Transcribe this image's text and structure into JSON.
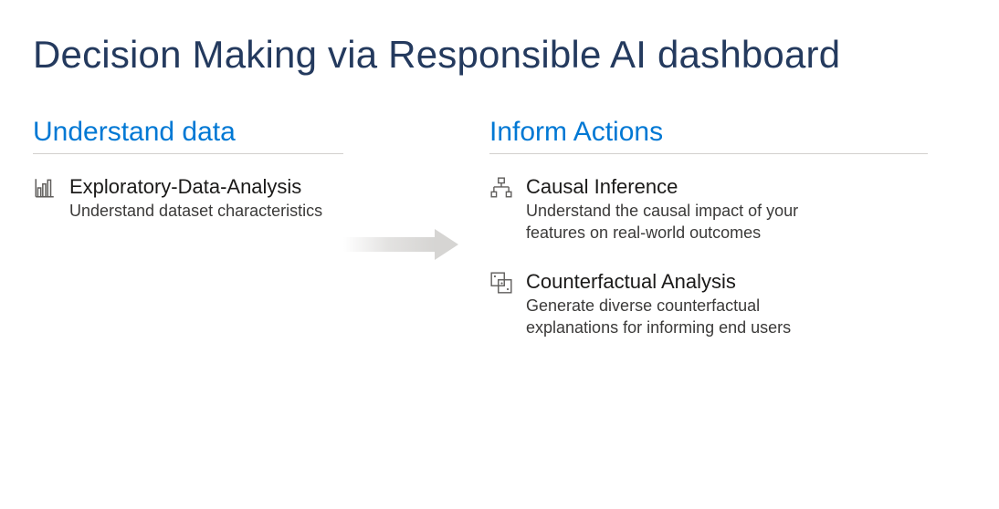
{
  "title": "Decision Making via Responsible AI dashboard",
  "left": {
    "heading": "Understand data",
    "items": [
      {
        "icon": "bar-chart-icon",
        "title": "Exploratory-Data-Analysis",
        "desc": "Understand dataset characteristics"
      }
    ]
  },
  "right": {
    "heading": "Inform Actions",
    "items": [
      {
        "icon": "hierarchy-icon",
        "title": "Causal Inference",
        "desc": "Understand the causal impact of your features on real-world outcomes"
      },
      {
        "icon": "dice-icon",
        "title": "Counterfactual Analysis",
        "desc": "Generate diverse counterfactual explanations for informing end users"
      }
    ]
  }
}
